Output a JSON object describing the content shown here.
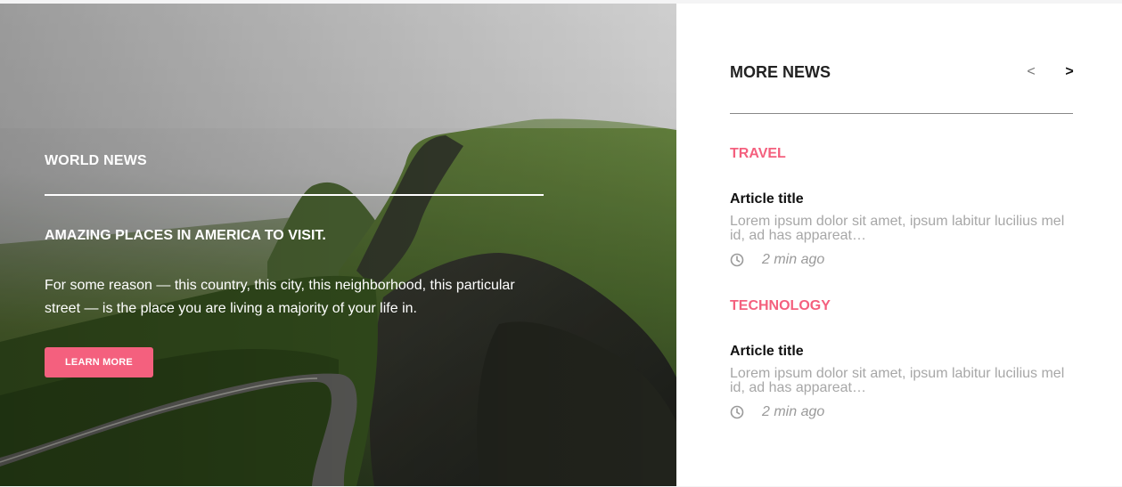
{
  "hero": {
    "category": "WORLD NEWS",
    "headline": "AMAZING PLACES IN AMERICA TO VISIT.",
    "excerpt": "For some reason — this country, this city, this neighborhood, this particular street — is the place you are living a majority of your life in.",
    "button_label": "LEARN MORE",
    "image_description": "misty green mountain valley with a winding road",
    "colors": {
      "accent": "#f4607e",
      "text": "#ffffff"
    }
  },
  "sidebar": {
    "title": "MORE NEWS",
    "prev_label": "<",
    "next_label": ">",
    "items": [
      {
        "category": "TRAVEL",
        "title": "Article title",
        "summary": "Lorem ipsum dolor sit amet, ipsum labitur lucilius mel id, ad has appareat…",
        "time": "2 min ago",
        "icon": "clock-icon"
      },
      {
        "category": "TECHNOLOGY",
        "title": "Article title",
        "summary": "Lorem ipsum dolor sit amet, ipsum labitur lucilius mel id, ad has appareat…",
        "time": "2 min ago",
        "icon": "clock-icon"
      }
    ],
    "colors": {
      "category": "#f4607e",
      "muted": "#a7a7a7",
      "heading": "#222222"
    }
  }
}
